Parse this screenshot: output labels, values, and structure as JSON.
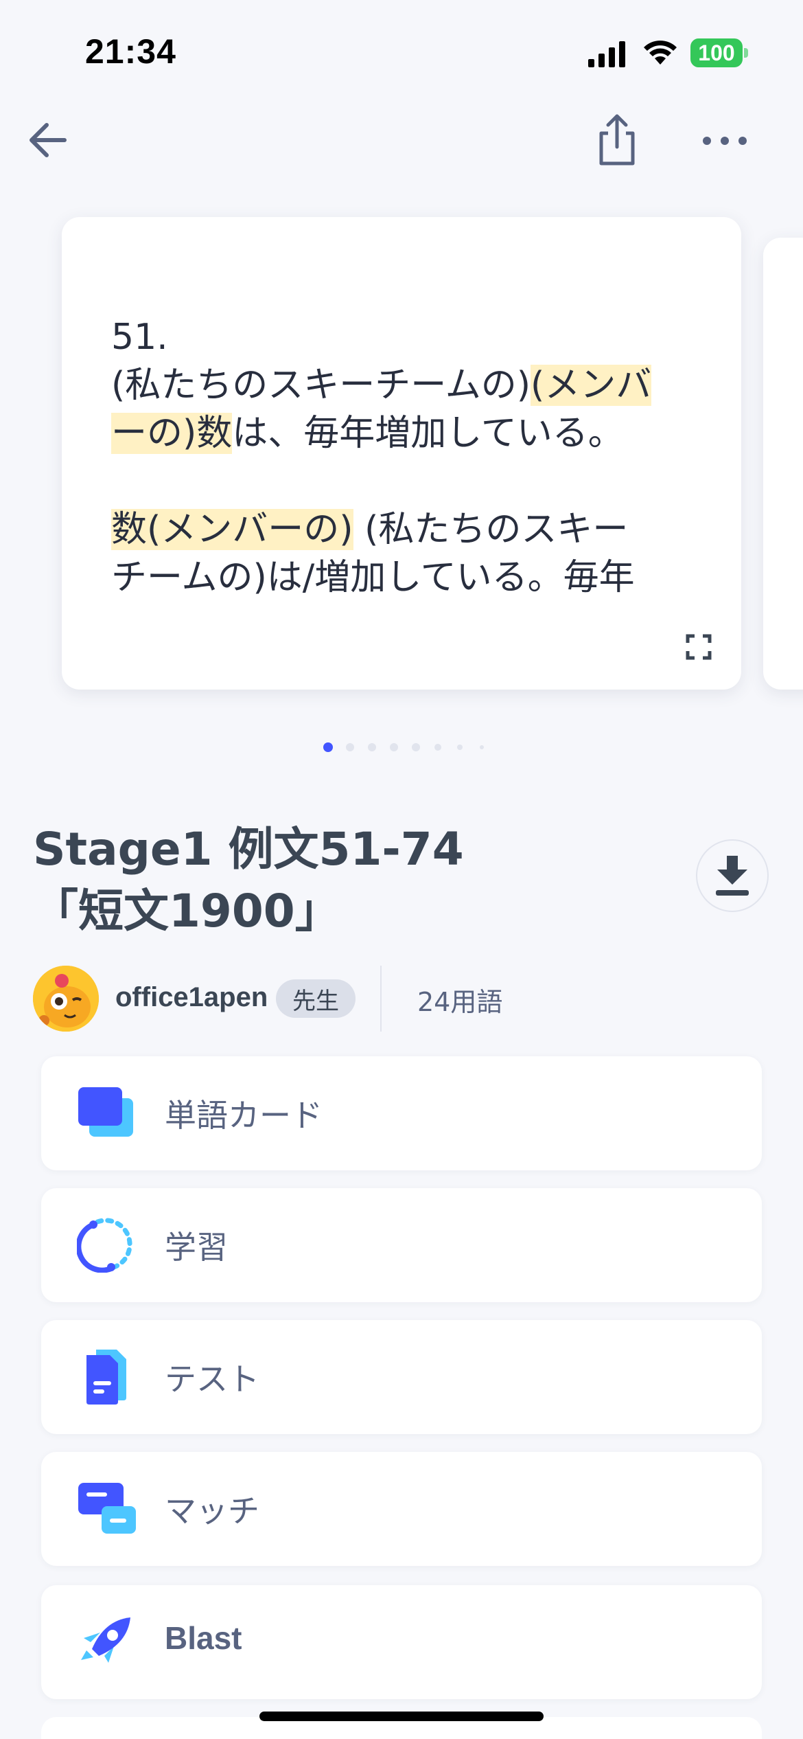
{
  "status_bar": {
    "time": "21:34",
    "battery": "100"
  },
  "card": {
    "lines": [
      {
        "t": "51.",
        "h": false
      },
      {
        "t": "\n(私たちのスキーチームの)",
        "h": false
      },
      {
        "t": "(メンバ\nーの)数",
        "h": true
      },
      {
        "t": "は、毎年増加している。\n\n",
        "h": false
      },
      {
        "t": "数(メンバーの)",
        "h": true
      },
      {
        "t": " (私たちのスキー\nチームの)は/増加している。毎年",
        "h": false
      }
    ],
    "highlight_color": "#fff1c4"
  },
  "pagination": {
    "count": 8,
    "active_index": 0,
    "active_color": "#4255ff"
  },
  "set": {
    "title": "Stage1 例文51-74\n「短文1900」",
    "author": "office1apen",
    "badge": "先生",
    "term_count": "24用語"
  },
  "modes": [
    {
      "label": "単語カード",
      "icon": "flashcards-icon"
    },
    {
      "label": "学習",
      "icon": "learn-icon"
    },
    {
      "label": "テスト",
      "icon": "test-icon"
    },
    {
      "label": "マッチ",
      "icon": "match-icon"
    },
    {
      "label": "Blast",
      "icon": "blast-rocket-icon"
    }
  ],
  "colors": {
    "accent": "#4255ff",
    "accent_light": "#4dc6ff",
    "background": "#f6f7fb",
    "text_secondary": "#586380"
  }
}
